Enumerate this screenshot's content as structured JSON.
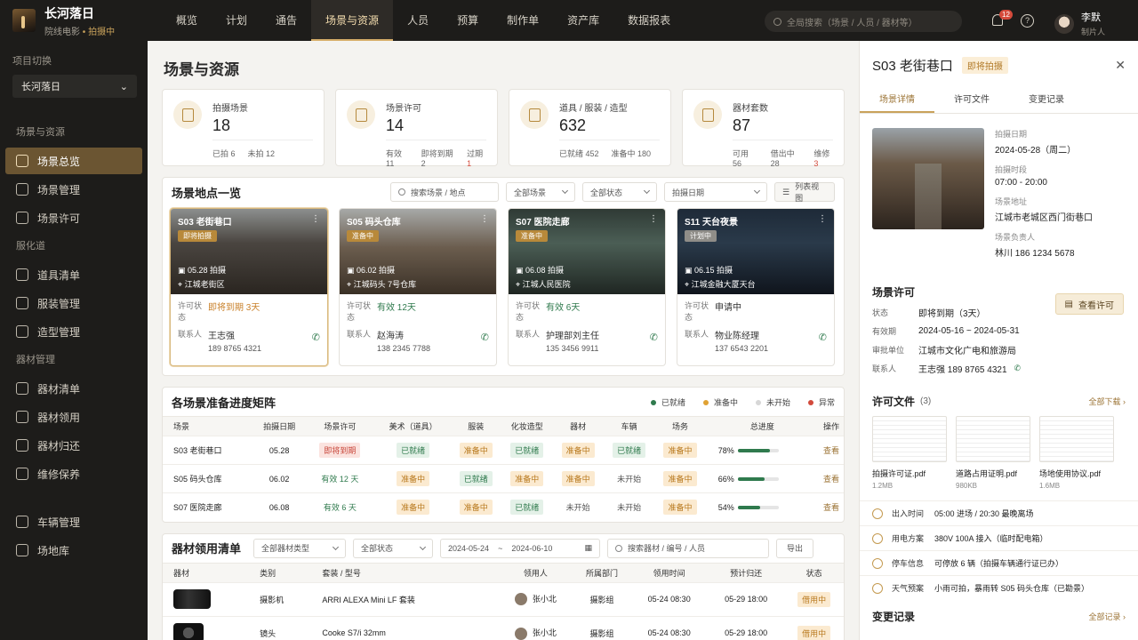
{
  "brand": {
    "title": "长河落日",
    "company": "院线电影",
    "status": "拍摄中"
  },
  "sidebar": {
    "project_label": "项目切换",
    "project_value": "长河落日",
    "groups": [
      {
        "title": "场景与资源",
        "items": [
          {
            "label": "场景总览",
            "active": true
          },
          {
            "label": "场景管理"
          },
          {
            "label": "场景许可"
          }
        ]
      },
      {
        "title": "服化道",
        "items": [
          {
            "label": "道具清单"
          },
          {
            "label": "服装管理"
          },
          {
            "label": "造型管理"
          }
        ]
      },
      {
        "title": "器材管理",
        "items": [
          {
            "label": "器材清单"
          },
          {
            "label": "器材领用"
          },
          {
            "label": "器材归还"
          },
          {
            "label": "维修保养"
          }
        ]
      },
      {
        "title": "",
        "items": [
          {
            "label": "车辆管理"
          },
          {
            "label": "场地库"
          }
        ]
      }
    ]
  },
  "topnav": {
    "tabs": [
      "概览",
      "计划",
      "通告",
      "场景与资源",
      "人员",
      "预算",
      "制作单",
      "资产库",
      "数据报表"
    ],
    "active": 3,
    "search_placeholder": "全局搜索（场景 / 人员 / 器材等）",
    "notif_count": "12",
    "user_name": "李默",
    "user_role": "制片人"
  },
  "main": {
    "title": "场景与资源",
    "stats": [
      {
        "label": "拍摄场景",
        "value": "18",
        "subs": [
          {
            "t": "已拍 6"
          },
          {
            "t": "未拍 12"
          }
        ]
      },
      {
        "label": "场景许可",
        "value": "14",
        "subs": [
          {
            "t": "有效 11"
          },
          {
            "t": "即将到期 2"
          },
          {
            "t": "过期 ",
            "n": "1"
          }
        ]
      },
      {
        "label": "道具 / 服装 / 造型",
        "value": "632",
        "subs": [
          {
            "t": "已就绪 452"
          },
          {
            "t": "准备中 180"
          }
        ]
      },
      {
        "label": "器材套数",
        "value": "87",
        "subs": [
          {
            "t": "可用 56"
          },
          {
            "t": "借出中28"
          },
          {
            "t": "维修",
            "n": "3"
          }
        ]
      }
    ],
    "locations": {
      "title": "场景地点一览",
      "search_placeholder": "搜索场景 / 地点",
      "filter_scene": "全部场景",
      "filter_status": "全部状态",
      "filter_date": "拍摄日期",
      "view_btn": "列表视图",
      "cards": [
        {
          "name": "S03  老街巷口",
          "tag": "即将拍摄",
          "date": "05.28 拍摄",
          "loc": "江城老街区",
          "permit_key": "许可状态",
          "permit": "即将到期 3天",
          "contact_key": "联系人",
          "contact": "王志强",
          "phone": "189 8765 4321"
        },
        {
          "name": "S05  码头仓库",
          "tag": "准备中",
          "date": "06.02 拍摄",
          "loc": "江城码头 7号仓库",
          "permit_key": "许可状态",
          "permit": "有效 12天",
          "contact_key": "联系人",
          "contact": "赵海涛",
          "phone": "138 2345 7788"
        },
        {
          "name": "S07  医院走廊",
          "tag": "准备中",
          "date": "06.08 拍摄",
          "loc": "江城人民医院",
          "permit_key": "许可状态",
          "permit": "有效 6天",
          "contact_key": "联系人",
          "contact": "护理部刘主任",
          "phone": "135 3456 9911"
        },
        {
          "name": "S11  天台夜景",
          "tag": "计划中",
          "date": "06.15 拍摄",
          "loc": "江城金融大厦天台",
          "permit_key": "许可状态",
          "permit": "申请中",
          "contact_key": "联系人",
          "contact": "物业陈经理",
          "phone": "137 6543 2201"
        }
      ]
    },
    "matrix": {
      "title": "各场景准备进度矩阵",
      "legend": [
        "已就绪",
        "准备中",
        "未开始",
        "异常"
      ],
      "headers": [
        "场景",
        "拍摄日期",
        "场景许可",
        "美术（道具）",
        "服装",
        "化妆造型",
        "器材",
        "车辆",
        "场务",
        "总进度",
        "操作"
      ],
      "rows": [
        {
          "scene": "S03  老街巷口",
          "date": "05.28",
          "permit": "即将到期",
          "cells": [
            "已就绪",
            "准备中",
            "已就绪",
            "准备中",
            "已就绪",
            "准备中"
          ],
          "progress": "78%",
          "pct": 78,
          "op": "查看"
        },
        {
          "scene": "S05  码头仓库",
          "date": "06.02",
          "permit": "有效 12 天",
          "cells": [
            "准备中",
            "已就绪",
            "准备中",
            "准备中",
            "未开始",
            "准备中"
          ],
          "progress": "66%",
          "pct": 66,
          "op": "查看"
        },
        {
          "scene": "S07  医院走廊",
          "date": "06.08",
          "permit": "有效 6 天",
          "cells": [
            "准备中",
            "准备中",
            "已就绪",
            "未开始",
            "未开始",
            "准备中"
          ],
          "progress": "54%",
          "pct": 54,
          "op": "查看"
        }
      ]
    },
    "equipment": {
      "title": "器材领用清单",
      "filter_type": "全部器材类型",
      "filter_status": "全部状态",
      "date_from": "2024-05-24",
      "date_sep": "~",
      "date_to": "2024-06-10",
      "search_placeholder": "搜索器材 / 编号 / 人员",
      "export": "导出",
      "headers": [
        "器材",
        "类别",
        "套装 / 型号",
        "领用人",
        "所属部门",
        "领用时间",
        "预计归还",
        "状态"
      ],
      "rows": [
        {
          "type": "摄影机",
          "model": "ARRI ALEXA Mini LF  套装",
          "user": "张小北",
          "dept": "摄影组",
          "out": "05-24 08:30",
          "back": "05-29 18:00",
          "status": "借用中"
        },
        {
          "type": "镜头",
          "model": "Cooke S7/i 32mm",
          "user": "张小北",
          "dept": "摄影组",
          "out": "05-24 08:30",
          "back": "05-29 18:00",
          "status": "借用中"
        }
      ]
    }
  },
  "detail": {
    "title": "S03  老街巷口",
    "tag": "即将拍摄",
    "tabs": [
      "场景详情",
      "许可文件",
      "变更记录"
    ],
    "fields": [
      {
        "k": "拍摄日期",
        "v": "2024-05-28（周二）"
      },
      {
        "k": "拍摄时段",
        "v": "07:00 - 20:00"
      },
      {
        "k": "场景地址",
        "v": "江城市老城区西门街巷口"
      },
      {
        "k": "场景负责人",
        "v": "林川   186 1234 5678"
      }
    ],
    "permit_title": "场景许可",
    "permit_btn": "查看许可",
    "permit": [
      {
        "k": "状态",
        "v": "即将到期（3天）"
      },
      {
        "k": "有效期",
        "v": "2024-05-16 ~ 2024-05-31"
      },
      {
        "k": "审批单位",
        "v": "江城市文化广电和旅游局"
      },
      {
        "k": "联系人",
        "v": "王志强   189 8765 4321"
      }
    ],
    "files_title": "许可文件",
    "files_count": "(3)",
    "files_all": "全部下载",
    "files": [
      {
        "name": "拍摄许可证.pdf",
        "size": "1.2MB"
      },
      {
        "name": "道路占用证明.pdf",
        "size": "980KB"
      },
      {
        "name": "场地使用协议.pdf",
        "size": "1.6MB"
      }
    ],
    "info": [
      {
        "k": "出入时间",
        "v": "05:00 进场 / 20:30 最晚离场"
      },
      {
        "k": "用电方案",
        "v": "380V  100A 接入（临时配电箱）"
      },
      {
        "k": "停车信息",
        "v": "可停放 6 辆（拍摄车辆通行证已办）"
      },
      {
        "k": "天气预案",
        "v": "小雨可拍，暴雨转 S05 码头仓库（已勘景）"
      }
    ],
    "changes_title": "变更记录",
    "changes_all": "全部记录"
  }
}
